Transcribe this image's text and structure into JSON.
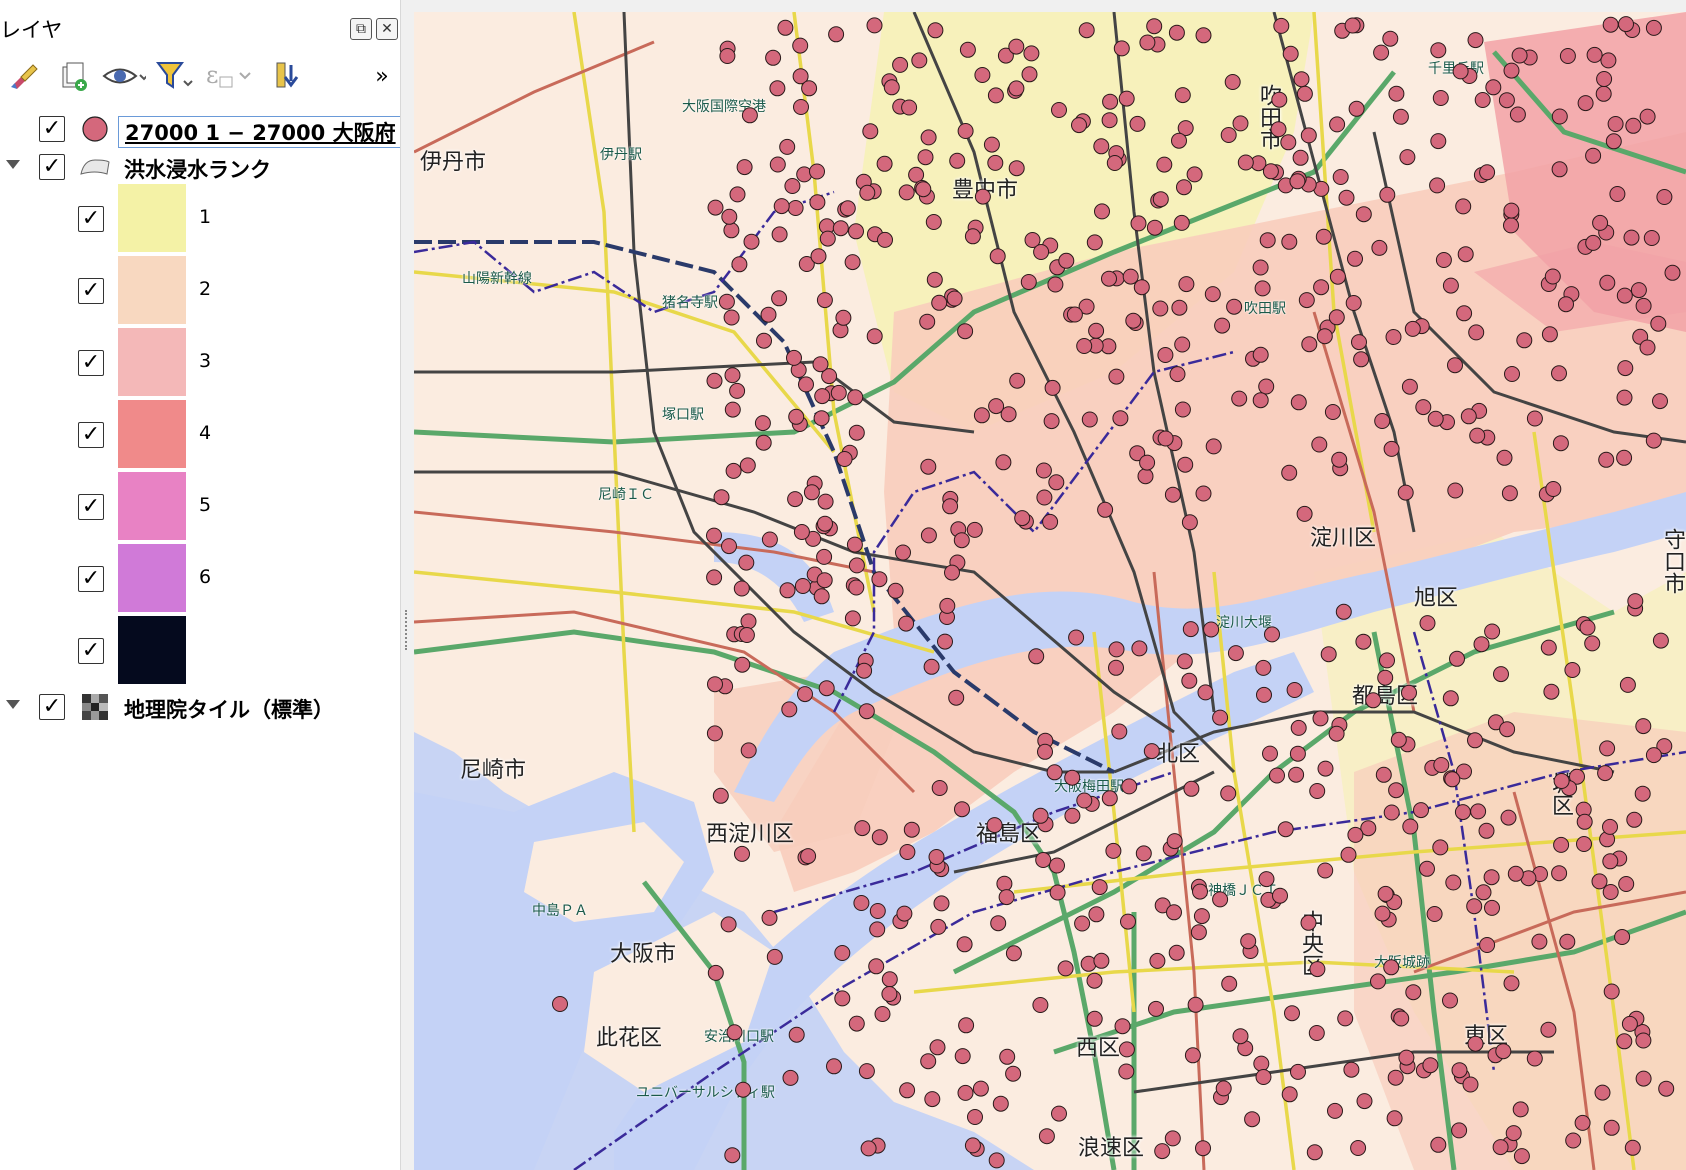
{
  "panel": {
    "title": "レイヤ",
    "float_button": "⧉",
    "close_button": "✕",
    "toolbar_overflow": "»"
  },
  "toolbar": {
    "icons": [
      "paint-brush-icon",
      "add-group-icon",
      "eye-visibility-icon",
      "filter-icon",
      "expression-filter-icon",
      "move-down-icon"
    ]
  },
  "layers": {
    "points": {
      "label": "27000 1 − 27000 大阪府",
      "checked": true,
      "color": "#d4687c"
    },
    "flood": {
      "label": "洪水浸水ランク",
      "checked": true,
      "classes": [
        {
          "label": "1",
          "color": "#f4f2a6"
        },
        {
          "label": "2",
          "color": "#f8d8c0"
        },
        {
          "label": "3",
          "color": "#f4b8b8"
        },
        {
          "label": "4",
          "color": "#f08a8a"
        },
        {
          "label": "5",
          "color": "#e882c4"
        },
        {
          "label": "6",
          "color": "#d07ad8"
        },
        {
          "label": "",
          "color": "#050a1e"
        }
      ]
    },
    "basemap": {
      "label": "地理院タイル（標準）",
      "checked": true
    }
  },
  "map": {
    "colors": {
      "water": "#c4d2f6",
      "land": "#fbece0",
      "flood_low": "#f6f2b4",
      "flood_mid": "#f8cdbc",
      "flood_high": "#f2a2a6",
      "expressway": "#5aa86a",
      "national_road": "#e8d84a",
      "railway": "#444444",
      "shinkansen": "#2a3a6a",
      "boundary": "#3a2a9a",
      "point": "#d4687c"
    },
    "places": {
      "itami": "伊丹市",
      "toyonaka": "豊中市",
      "suita": "吹田市",
      "amagasaki": "尼崎市",
      "nishiyodogawa": "西淀川区",
      "osaka": "大阪市",
      "konohana": "此花区",
      "kita": "北区",
      "asahi": "旭区",
      "miyakojima": "都島区",
      "yodogawa": "淀川区",
      "fukushima": "福島区",
      "chuo": "中央区",
      "naniwa": "浪速区",
      "nishi": "西区",
      "moriguchi": "守口市",
      "higashi": "東区",
      "jo": "城区"
    },
    "stations": {
      "airport": "大阪国際空港",
      "itami_sta": "伊丹駅",
      "inadera": "猪名寺駅",
      "tsukaguchi": "塚口駅",
      "amagasaki_ic": "尼崎ＩＣ",
      "sanyo": "山陽新幹線",
      "umeda": "大阪梅田駅",
      "tenjinbashi": "天神橋ＪＣＴ",
      "osaka_castle": "大阪城跡",
      "ajikawaguchi": "安治川口駅",
      "usj": "ユニバーサルシティ駅",
      "nakajima": "中島ＰＡ",
      "yodo_weir": "淀川大堰",
      "suita_sta": "吹田駅",
      "senri": "千里丘駅"
    }
  }
}
